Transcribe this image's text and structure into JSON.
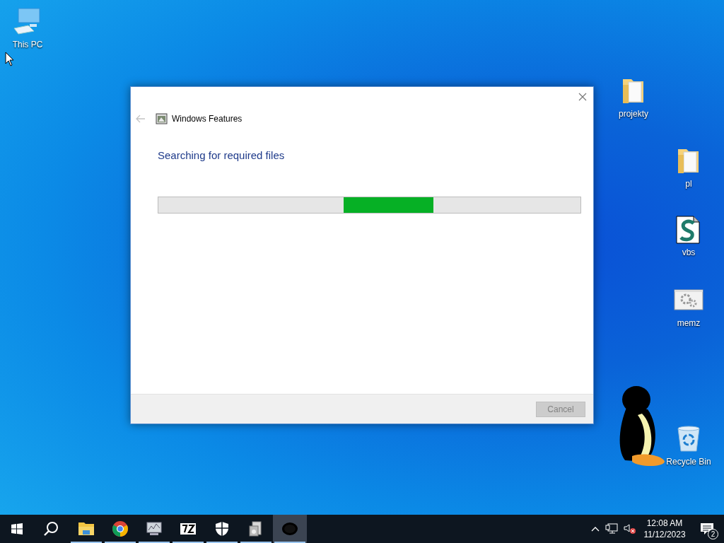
{
  "desktop_icons": [
    {
      "label": "This PC",
      "kind": "pc"
    },
    {
      "label": "projekty",
      "kind": "folder"
    },
    {
      "label": "pl",
      "kind": "folder"
    },
    {
      "label": "vbs",
      "kind": "script"
    },
    {
      "label": "memz",
      "kind": "app"
    },
    {
      "label": "Recycle Bin",
      "kind": "recycle"
    }
  ],
  "window": {
    "title": "Windows Features",
    "back_disabled": true,
    "heading": "Searching for required files",
    "progress": {
      "marquee": true
    },
    "buttons": [
      {
        "label": "Cancel",
        "disabled": true
      }
    ]
  },
  "taskbar": {
    "apps": [
      {
        "kind": "explorer",
        "running": true,
        "selected": false
      },
      {
        "kind": "browser",
        "running": true,
        "selected": false
      },
      {
        "kind": "monitor",
        "running": true,
        "selected": false
      },
      {
        "kind": "archiver",
        "running": true,
        "selected": false
      },
      {
        "kind": "shield",
        "running": true,
        "selected": false
      },
      {
        "kind": "installer",
        "running": true,
        "selected": false
      },
      {
        "kind": "mascot",
        "running": true,
        "selected": true
      }
    ],
    "time": "12:08 AM",
    "date": "11/12/2023",
    "notifications": "2"
  }
}
